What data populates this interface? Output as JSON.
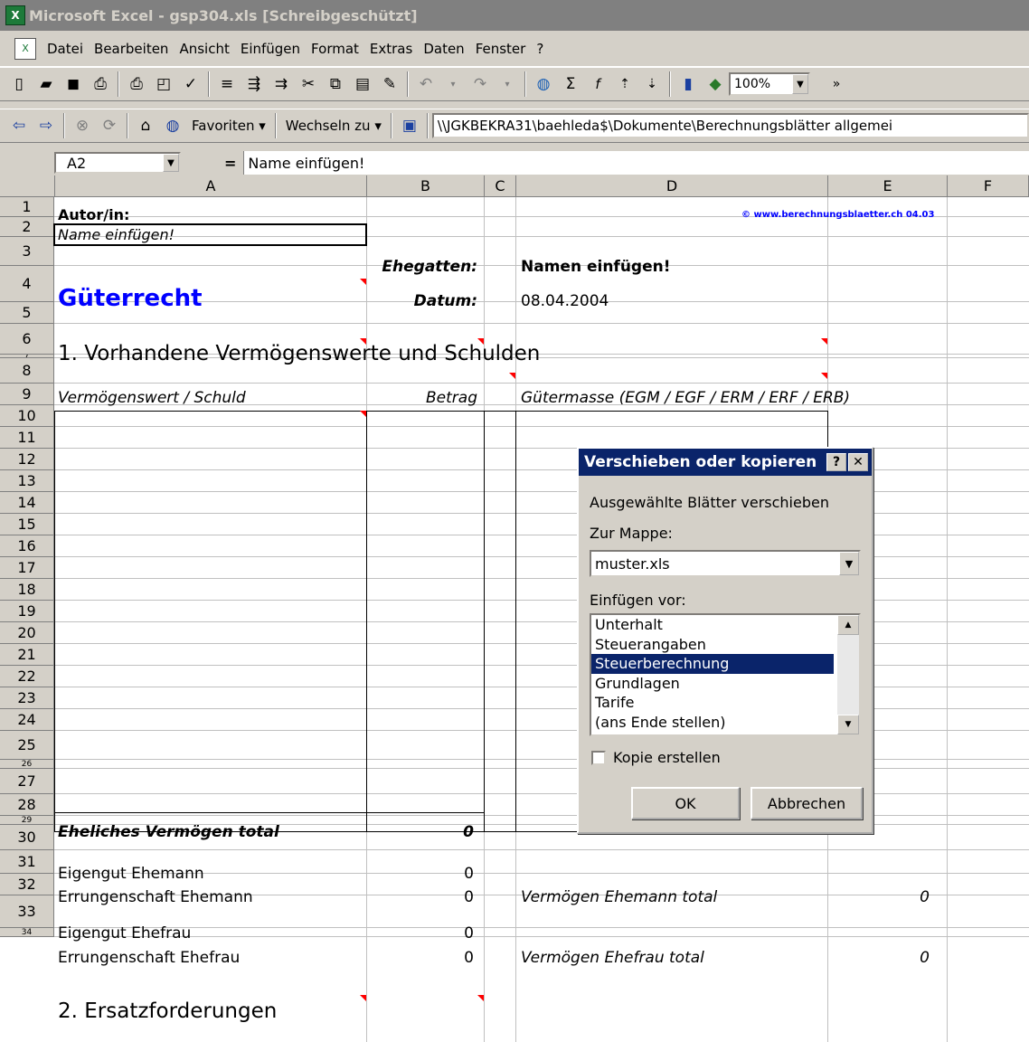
{
  "window": {
    "title": "Microsoft Excel - gsp304.xls  [Schreibgeschützt]"
  },
  "menu": [
    "Datei",
    "Bearbeiten",
    "Ansicht",
    "Einfügen",
    "Format",
    "Extras",
    "Daten",
    "Fenster",
    "?"
  ],
  "toolbar": {
    "zoom": "100%"
  },
  "web_toolbar": {
    "favorites": "Favoriten ▾",
    "goto": "Wechseln zu ▾",
    "address": "\\\\JGKBEKRA31\\baehleda$\\Dokumente\\Berechnungsblätter allgemei"
  },
  "formula_bar": {
    "name_box": "A2",
    "eq": "=",
    "value": "Name einfügen!"
  },
  "columns": [
    "A",
    "B",
    "C",
    "D",
    "E",
    "F"
  ],
  "rows": [
    "1",
    "2",
    "3",
    "4",
    "5",
    "6",
    "7",
    "8",
    "9",
    "10",
    "11",
    "12",
    "13",
    "14",
    "15",
    "16",
    "17",
    "18",
    "19",
    "20",
    "21",
    "22",
    "23",
    "24",
    "25",
    "26",
    "27",
    "28",
    "29",
    "30",
    "31",
    "32",
    "33",
    "34"
  ],
  "cells": {
    "a1": "Autor/in:",
    "d1": "© www.berechnungsblaetter.ch 04.03",
    "a2": "Name einfügen!",
    "b3": "Ehegatten:",
    "d3": "Namen einfügen!",
    "a4": "Güterrecht",
    "b4": "Datum:",
    "d4": "08.04.2004",
    "a6": "1. Vorhandene Vermögenswerte und Schulden",
    "a8": "Vermögenswert / Schuld",
    "b8": "Betrag",
    "d8": "Gütermasse (EGM / EGF / ERM / ERF / ERB)",
    "a25": "Eheliches Vermögen total",
    "b25": "0",
    "a27": "Eigengut Ehemann",
    "b27": "0",
    "a28": "Errungenschaft Ehemann",
    "b28": "0",
    "d28": "Vermögen Ehemann total",
    "e28": "0",
    "a30": "Eigengut Ehefrau",
    "b30": "0",
    "a31": "Errungenschaft Ehefrau",
    "b31": "0",
    "d31": "Vermögen Ehefrau total",
    "e31": "0",
    "a33": "2. Ersatzforderungen"
  },
  "dialog": {
    "title": "Verschieben oder kopieren",
    "help": "?",
    "close": "✕",
    "desc": "Ausgewählte Blätter verschieben",
    "to_book_label": "Zur Mappe:",
    "to_book_value": "muster.xls",
    "before_label": "Einfügen vor:",
    "sheets": [
      "Unterhalt",
      "Steuerangaben",
      "Steuerberechnung",
      "Grundlagen",
      "Tarife",
      "(ans Ende stellen)"
    ],
    "selected_sheet": "Steuerberechnung",
    "copy_label": "Kopie erstellen",
    "copy_checked": false,
    "ok": "OK",
    "cancel": "Abbrechen"
  }
}
